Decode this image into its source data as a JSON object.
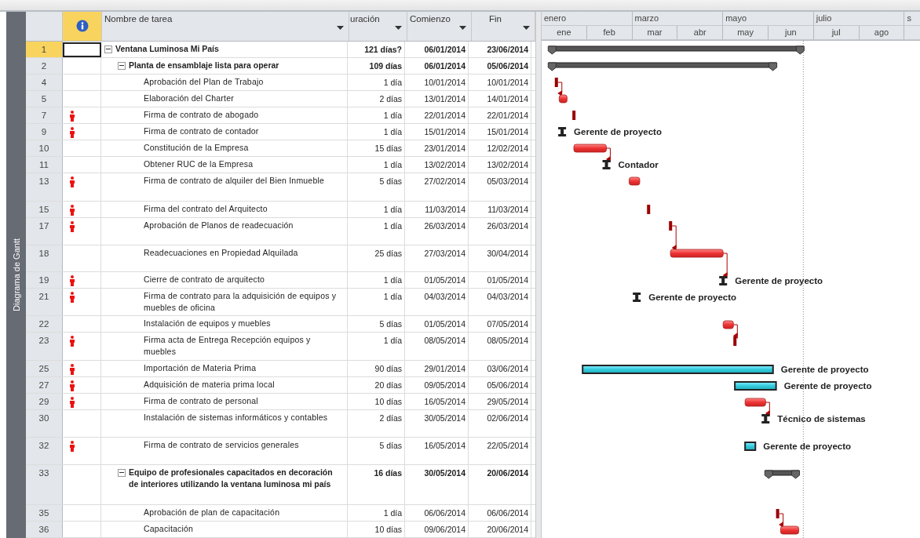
{
  "view_bar": {
    "label": "Diagrama de Gantt"
  },
  "columns": [
    {
      "kind": "indicators",
      "selected": true
    },
    {
      "kind": "name",
      "label": "Nombre de tarea",
      "selected": false
    },
    {
      "kind": "duration",
      "label": "uración",
      "selected": false
    },
    {
      "kind": "start",
      "label": "Comienzo",
      "selected": false
    },
    {
      "kind": "finish",
      "label": "Fin",
      "selected": false
    }
  ],
  "timescale": {
    "top": [
      "enero",
      "marzo",
      "mayo",
      "julio",
      "s"
    ],
    "bottom": [
      "ene",
      "feb",
      "mar",
      "abr",
      "may",
      "jun",
      "jul",
      "ago"
    ]
  },
  "tasks": [
    {
      "id": "1",
      "name": "Ventana Luminosa Mi País",
      "duration": "121 días?",
      "start": "06/01/2014",
      "finish": "23/06/2014",
      "selected": true,
      "indicator": false,
      "expanded": true,
      "bar": {
        "kind": "summary",
        "linked": false
      },
      "children": [
        {
          "id": "2",
          "name": "Planta de ensamblaje lista para operar",
          "duration": "109 días",
          "start": "06/01/2014",
          "finish": "05/06/2014",
          "selected": false,
          "indicator": false,
          "expanded": true,
          "bar": {
            "kind": "summary",
            "linked": false
          },
          "children": [
            {
              "id": "4",
              "name": "Aprobación del Plan de Trabajo",
              "duration": "1 día",
              "start": "10/01/2014",
              "finish": "10/01/2014",
              "selected": false,
              "indicator": false,
              "bar": {
                "kind": "task",
                "linked": false
              }
            },
            {
              "id": "5",
              "name": "Elaboración del Charter",
              "duration": "2 días",
              "start": "13/01/2014",
              "finish": "14/01/2014",
              "selected": false,
              "indicator": false,
              "bar": {
                "kind": "task",
                "linked": true
              }
            },
            {
              "id": "7",
              "name": "Firma de contrato de abogado",
              "duration": "1 día",
              "start": "22/01/2014",
              "finish": "22/01/2014",
              "selected": false,
              "indicator": true,
              "bar": {
                "kind": "task",
                "linked": false
              }
            },
            {
              "id": "9",
              "name": "Firma de contrato de contador",
              "duration": "1 día",
              "start": "15/01/2014",
              "finish": "15/01/2014",
              "selected": false,
              "indicator": true,
              "bar": {
                "kind": "marker",
                "linked": false,
                "resource": "Gerente de proyecto"
              }
            },
            {
              "id": "10",
              "name": "Constitución de la Empresa",
              "duration": "15 días",
              "start": "23/01/2014",
              "finish": "12/02/2014",
              "selected": false,
              "indicator": false,
              "bar": {
                "kind": "task",
                "linked": false
              }
            },
            {
              "id": "11",
              "name": "Obtener RUC de la Empresa",
              "duration": "1 día",
              "start": "13/02/2014",
              "finish": "13/02/2014",
              "selected": false,
              "indicator": false,
              "bar": {
                "kind": "marker",
                "linked": true,
                "resource": "Contador"
              }
            },
            {
              "id": "13",
              "name": "Firma de contrato de alquiler del Bien Inmueble",
              "duration": "5 días",
              "start": "27/02/2014",
              "finish": "05/03/2014",
              "selected": false,
              "indicator": true,
              "bar": {
                "kind": "task",
                "linked": false
              }
            },
            {
              "id": "15",
              "name": "Firma del contrato del Arquitecto",
              "duration": "1 día",
              "start": "11/03/2014",
              "finish": "11/03/2014",
              "selected": false,
              "indicator": true,
              "bar": {
                "kind": "task",
                "linked": false
              }
            },
            {
              "id": "17",
              "name": "Aprobación de Planos de readecuación",
              "duration": "1 día",
              "start": "26/03/2014",
              "finish": "26/03/2014",
              "selected": false,
              "indicator": true,
              "bar": {
                "kind": "task",
                "linked": false
              }
            },
            {
              "id": "18",
              "name": "Readecuaciones en Propiedad Alquilada",
              "duration": "25 días",
              "start": "27/03/2014",
              "finish": "30/04/2014",
              "selected": false,
              "indicator": false,
              "bar": {
                "kind": "task",
                "linked": true
              }
            },
            {
              "id": "19",
              "name": "Cierre de contrato de arquitecto",
              "duration": "1 día",
              "start": "01/05/2014",
              "finish": "01/05/2014",
              "selected": false,
              "indicator": true,
              "bar": {
                "kind": "marker",
                "linked": true,
                "resource": "Gerente de proyecto"
              }
            },
            {
              "id": "21",
              "name": "Firma de contrato para la adquisición de equipos y muebles de oficina",
              "duration": "1 día",
              "start": "04/03/2014",
              "finish": "04/03/2014",
              "selected": false,
              "indicator": true,
              "bar": {
                "kind": "marker",
                "linked": false,
                "resource": "Gerente de proyecto"
              }
            },
            {
              "id": "22",
              "name": "Instalación de equipos y muebles",
              "duration": "5 días",
              "start": "01/05/2014",
              "finish": "07/05/2014",
              "selected": false,
              "indicator": false,
              "bar": {
                "kind": "task",
                "linked": false
              }
            },
            {
              "id": "23",
              "name": "Firma acta de Entrega Recepción equipos y muebles",
              "duration": "1 día",
              "start": "08/05/2014",
              "finish": "08/05/2014",
              "selected": false,
              "indicator": true,
              "bar": {
                "kind": "task",
                "linked": true
              }
            },
            {
              "id": "25",
              "name": "Importación de Materia Prima",
              "duration": "90 días",
              "start": "29/01/2014",
              "finish": "03/06/2014",
              "selected": false,
              "indicator": true,
              "bar": {
                "kind": "resource",
                "linked": false,
                "resource": "Gerente de proyecto"
              }
            },
            {
              "id": "27",
              "name": "Adquisición de materia prima local",
              "duration": "20 días",
              "start": "09/05/2014",
              "finish": "05/06/2014",
              "selected": false,
              "indicator": true,
              "bar": {
                "kind": "resource",
                "linked": false,
                "resource": "Gerente de proyecto"
              }
            },
            {
              "id": "29",
              "name": "Firma de contrato de personal",
              "duration": "10 días",
              "start": "16/05/2014",
              "finish": "29/05/2014",
              "selected": false,
              "indicator": true,
              "bar": {
                "kind": "task",
                "linked": false
              }
            },
            {
              "id": "30",
              "name": "Instalación de sistemas informáticos y contables",
              "duration": "2 días",
              "start": "30/05/2014",
              "finish": "02/06/2014",
              "selected": false,
              "indicator": false,
              "bar": {
                "kind": "marker",
                "linked": true,
                "resource": "Técnico de sistemas"
              }
            },
            {
              "id": "32",
              "name": "Firma de contrato de servicios generales",
              "duration": "5 días",
              "start": "16/05/2014",
              "finish": "22/05/2014",
              "selected": false,
              "indicator": true,
              "bar": {
                "kind": "resource",
                "linked": false,
                "resource": "Gerente de proyecto"
              }
            }
          ]
        },
        {
          "id": "33",
          "name": "Equipo de profesionales capacitados en decoración de interiores utilizando la ventana luminosa mi país",
          "duration": "16 días",
          "start": "30/05/2014",
          "finish": "20/06/2014",
          "selected": false,
          "indicator": false,
          "expanded": true,
          "bar": {
            "kind": "summary",
            "linked": false
          },
          "children": [
            {
              "id": "35",
              "name": "Aprobación de plan de capacitación",
              "duration": "1 día",
              "start": "06/06/2014",
              "finish": "06/06/2014",
              "selected": false,
              "indicator": false,
              "bar": {
                "kind": "task",
                "linked": false
              }
            },
            {
              "id": "36",
              "name": "Capacitación",
              "duration": "10 días",
              "start": "09/06/2014",
              "finish": "20/06/2014",
              "selected": false,
              "indicator": false,
              "bar": {
                "kind": "task",
                "linked": true
              }
            }
          ]
        }
      ]
    }
  ]
}
